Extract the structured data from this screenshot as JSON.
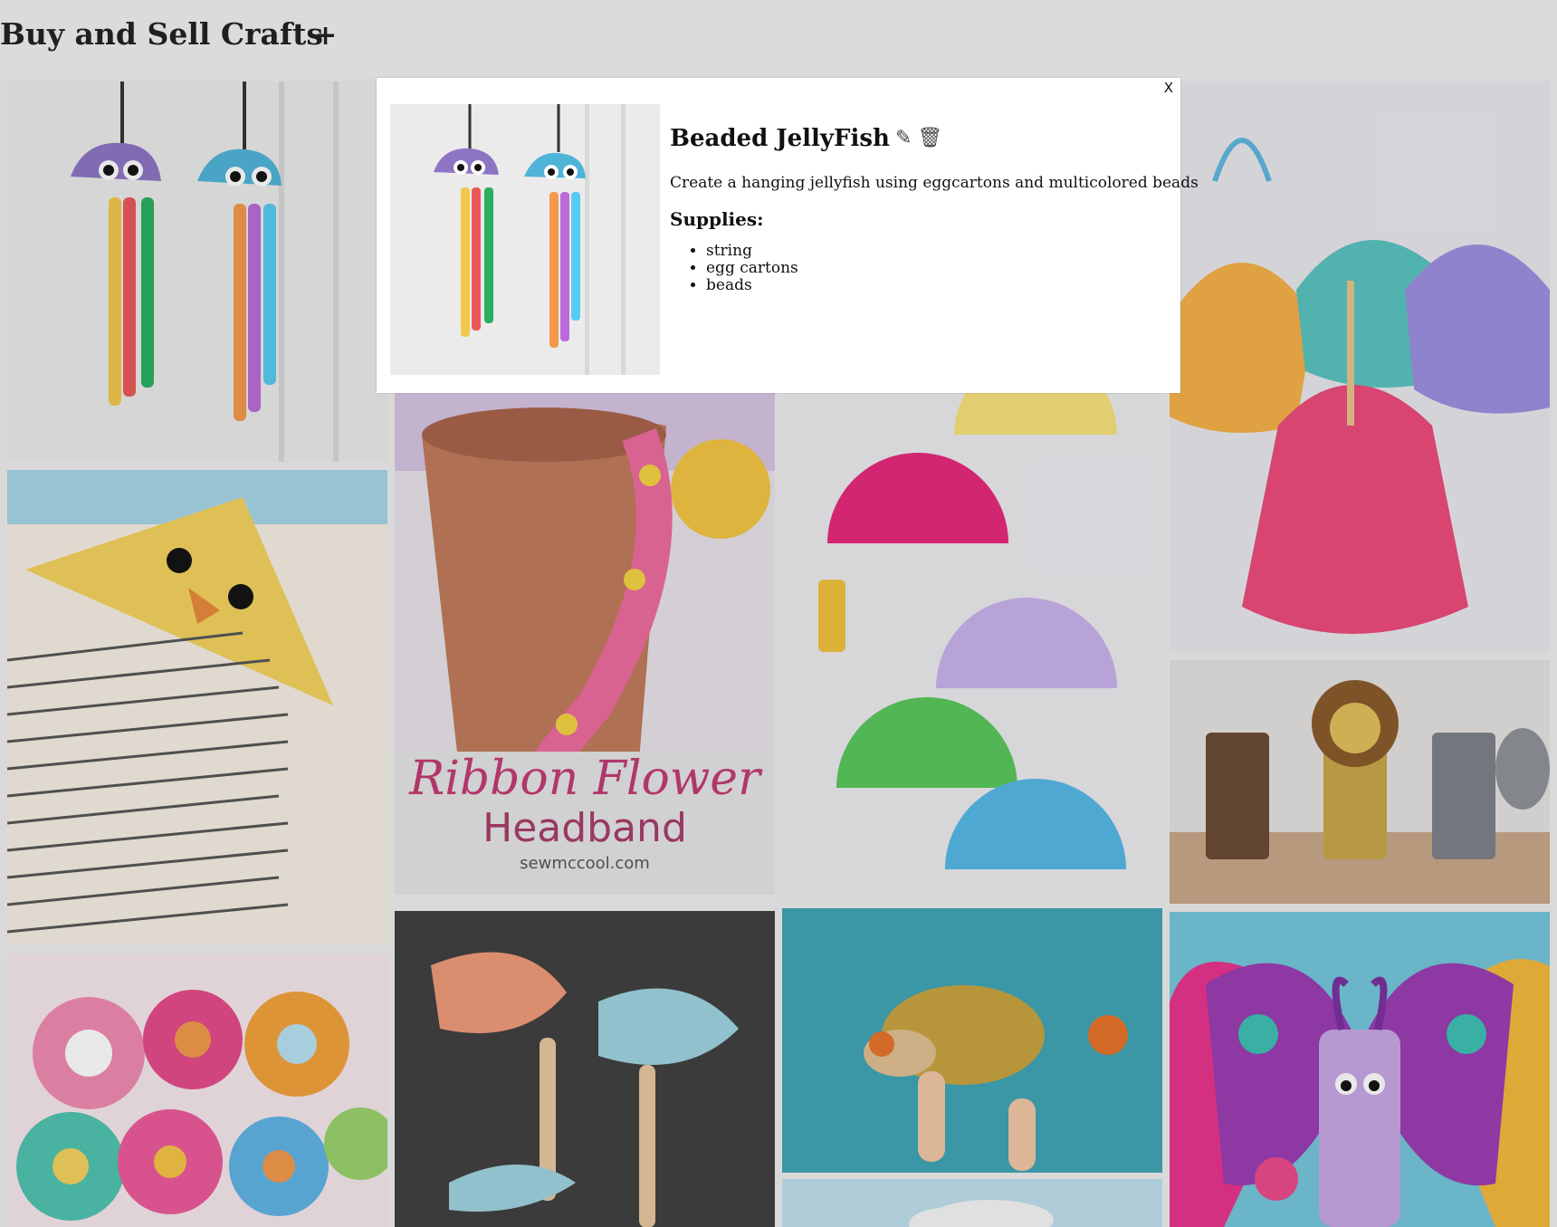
{
  "header": {
    "title": "Buy and Sell Crafts",
    "add_icon": "plus-icon",
    "add_label": "+"
  },
  "gallery": {
    "items": [
      {
        "name": "jellyfish"
      },
      {
        "name": "chick bookmark"
      },
      {
        "name": "felt flowers"
      },
      {
        "name": "ribbon flower headband",
        "caption_line1": "Ribbon Flower",
        "caption_line2": "Headband",
        "caption_site": "sewmccool.com"
      },
      {
        "name": "handprint fish"
      },
      {
        "name": "paper plate dinosaurs"
      },
      {
        "name": "leaf hedgehog"
      },
      {
        "name": "cloud"
      },
      {
        "name": "coffee filter dresses"
      },
      {
        "name": "toilet roll animals"
      },
      {
        "name": "toilet roll butterfly"
      }
    ]
  },
  "modal": {
    "close_label": "X",
    "title": "Beaded JellyFish",
    "edit_icon": "pencil-icon",
    "edit_glyph": "✎",
    "delete_icon": "trash-icon",
    "delete_glyph": "🗑",
    "description": "Create a hanging jellyfish using eggcartons and multicolored beads",
    "supplies_heading": "Supplies:",
    "supplies": [
      "string",
      "egg cartons",
      "beads"
    ]
  },
  "colors": {
    "background": "#d9d9d9",
    "modal_bg": "#ffffff"
  }
}
